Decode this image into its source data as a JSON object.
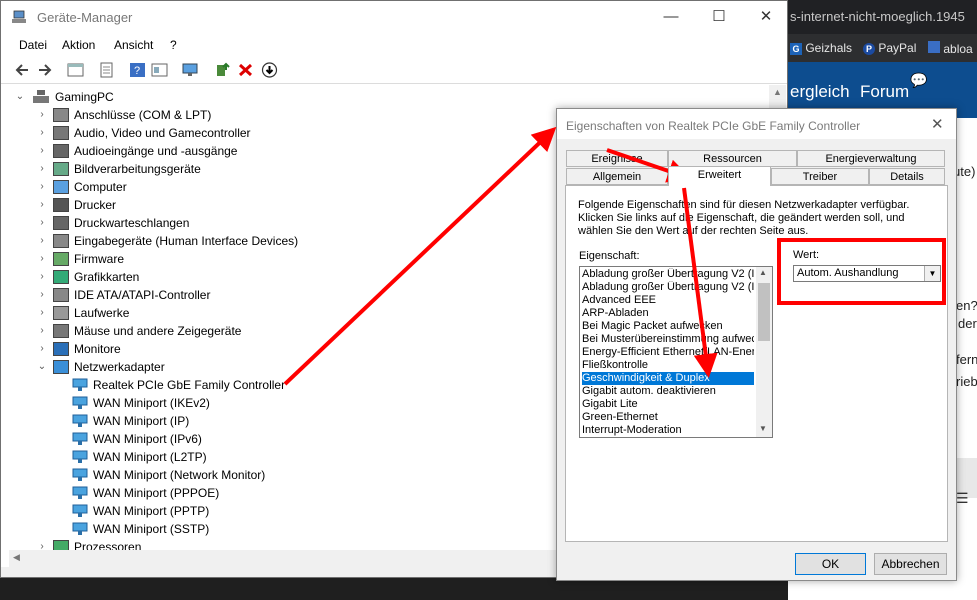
{
  "browser": {
    "url_fragment": "s-internet-nicht-moeglich.1945",
    "bookmarks": [
      {
        "label": "Geizhals",
        "icon": "geizhals-icon"
      },
      {
        "label": "PayPal",
        "icon": "paypal-icon"
      },
      {
        "label": "abloa",
        "icon": "ablo-icon"
      }
    ],
    "nav": {
      "item1": "ergleich",
      "item2": "Forum"
    },
    "side_text": [
      "ute)",
      "en?",
      "der",
      "ferne",
      "rieb"
    ]
  },
  "device_manager": {
    "title": "Geräte-Manager",
    "window_controls": {
      "minimize": "—",
      "maximize": "☐",
      "close": "✕"
    },
    "menu": [
      "Datei",
      "Aktion",
      "Ansicht",
      "?"
    ],
    "tree_root": "GamingPC",
    "categories": [
      "Anschlüsse (COM & LPT)",
      "Audio, Video und Gamecontroller",
      "Audioeingänge und -ausgänge",
      "Bildverarbeitungsgeräte",
      "Computer",
      "Drucker",
      "Druckwarteschlangen",
      "Eingabegeräte (Human Interface Devices)",
      "Firmware",
      "Grafikkarten",
      "IDE ATA/ATAPI-Controller",
      "Laufwerke",
      "Mäuse und andere Zeigegeräte",
      "Monitore",
      "Netzwerkadapter"
    ],
    "network_adapters": [
      "Realtek PCIe GbE Family Controller",
      "WAN Miniport (IKEv2)",
      "WAN Miniport (IP)",
      "WAN Miniport (IPv6)",
      "WAN Miniport (L2TP)",
      "WAN Miniport (Network Monitor)",
      "WAN Miniport (PPPOE)",
      "WAN Miniport (PPTP)",
      "WAN Miniport (SSTP)"
    ],
    "after_categories": [
      "Prozessoren"
    ]
  },
  "dialog": {
    "title": "Eigenschaften von Realtek PCIe GbE Family Controller",
    "close": "✕",
    "tabs_row1": [
      "Ereignisse",
      "Ressourcen",
      "Energieverwaltung"
    ],
    "tabs_row2": [
      "Allgemein",
      "Erweitert",
      "Treiber",
      "Details"
    ],
    "active_tab": "Erweitert",
    "description": "Folgende Eigenschaften sind für diesen Netzwerkadapter verfügbar. Klicken Sie links auf die Eigenschaft, die geändert werden soll, und wählen Sie den Wert auf der rechten Seite aus.",
    "property_label": "Eigenschaft:",
    "value_label": "Wert:",
    "properties": [
      "Abladung großer Übertragung V2 (IP",
      "Abladung großer Übertragung V2 (IP",
      "Advanced EEE",
      "ARP-Abladen",
      "Bei Magic Packet aufwecken",
      "Bei Musterübereinstimmung aufweck",
      "Energy-Efficient Ethernet/LAN-Energ",
      "Fließkontrolle",
      "Geschwindigkeit & Duplex",
      "Gigabit autom. deaktivieren",
      "Gigabit Lite",
      "Green-Ethernet",
      "Interrupt-Moderation"
    ],
    "selected_property": "Geschwindigkeit & Duplex",
    "value": "Autom. Aushandlung",
    "ok": "OK",
    "cancel": "Abbrechen"
  },
  "colors": {
    "accent": "#0078d7",
    "annotation": "#ff0000",
    "forum_nav": "#0d4d8f"
  }
}
